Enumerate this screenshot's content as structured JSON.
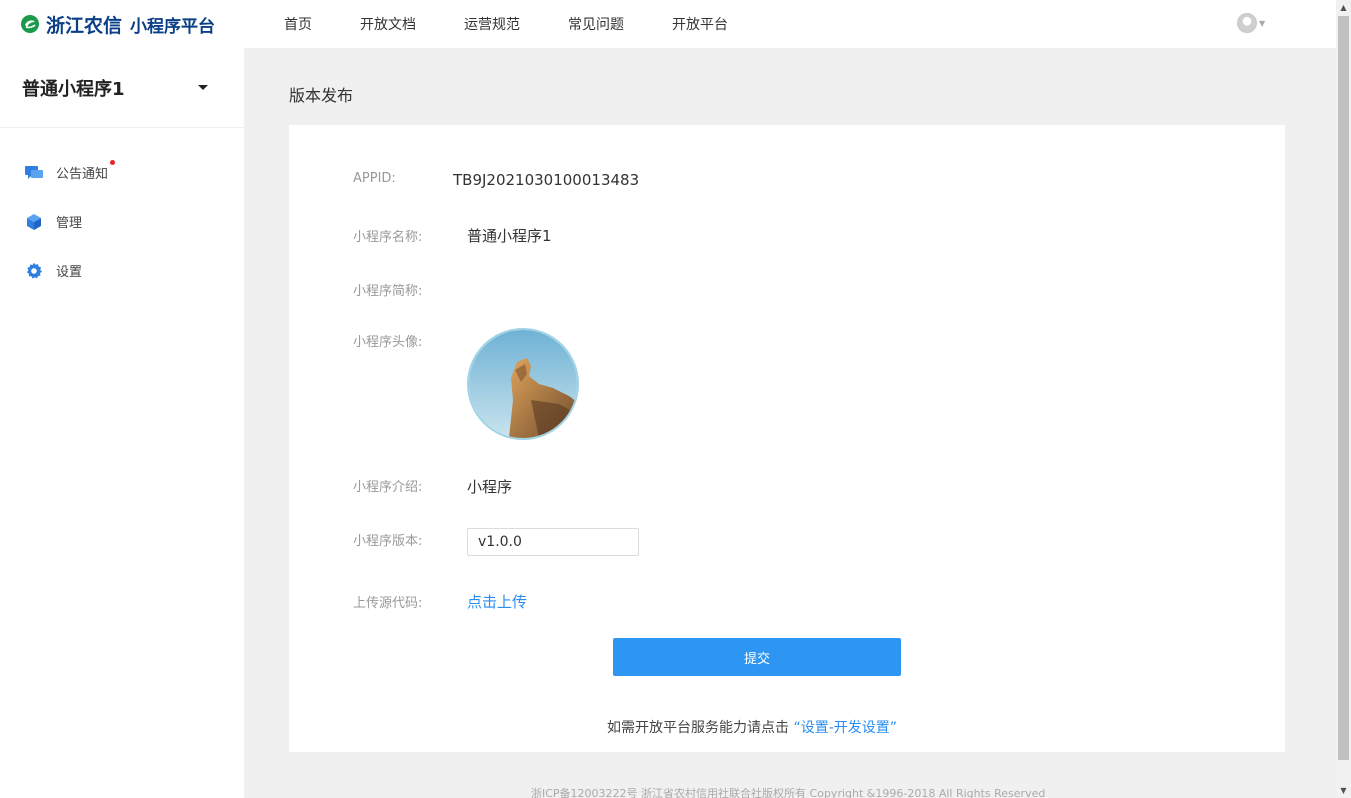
{
  "brand": {
    "name": "浙江农信",
    "subtitle": "小程序平台"
  },
  "nav": {
    "items": [
      {
        "label": "首页"
      },
      {
        "label": "开放文档"
      },
      {
        "label": "运营规范"
      },
      {
        "label": "常见问题"
      },
      {
        "label": "开放平台"
      }
    ]
  },
  "sidebar": {
    "app_name": "普通小程序1",
    "items": [
      {
        "label": "公告通知",
        "icon": "chat-bubble-icon",
        "has_dot": true
      },
      {
        "label": "管理",
        "icon": "cube-icon"
      },
      {
        "label": "设置",
        "icon": "gear-icon"
      }
    ]
  },
  "page": {
    "title": "版本发布"
  },
  "form": {
    "appid_label": "APPID:",
    "appid_value": "TB9J2021030100013483",
    "name_label": "小程序名称:",
    "name_value": "普通小程序1",
    "short_name_label": "小程序简称:",
    "avatar_label": "小程序头像:",
    "intro_label": "小程序介绍:",
    "intro_value": "小程序",
    "version_label": "小程序版本:",
    "version_value": "v1.0.0",
    "upload_label": "上传源代码:",
    "upload_link": "点击上传",
    "submit_label": "提交",
    "hint_text": "如需开放平台服务能力请点击 ",
    "hint_link": "“设置-开发设置”"
  },
  "footer": {
    "text": "浙ICP备12003222号 浙江省农村信用社联合社版权所有 Copyright &1996-2018 All Rights Reserved"
  },
  "colors": {
    "accent": "#2d96f2",
    "brand": "#0a3f87",
    "link": "#2a8ef0",
    "dot": "#e8242b"
  }
}
